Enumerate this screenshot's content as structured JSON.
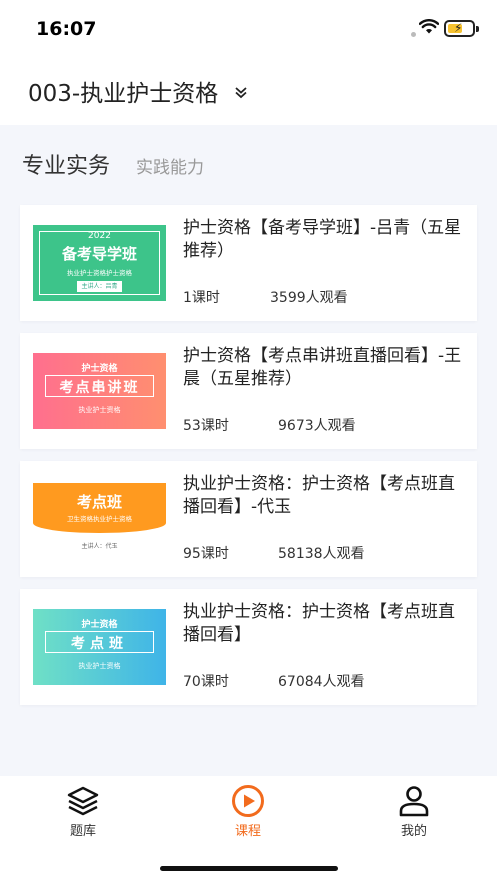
{
  "status_bar": {
    "time": "16:07"
  },
  "header": {
    "exam_title": "003-执业护士资格"
  },
  "tabs": [
    {
      "label": "专业实务",
      "active": true
    },
    {
      "label": "实践能力",
      "active": false
    }
  ],
  "courses": [
    {
      "title": "护士资格【备考导学班】-吕青（五星推荐）",
      "lessons": "1课时",
      "views": "3599人观看",
      "cover": {
        "year": "2022",
        "main": "备考导学班",
        "sub": "执业护士资格护士资格",
        "tag": "主讲人：吕青"
      }
    },
    {
      "title": "护士资格【考点串讲班直播回看】-王晨（五星推荐）",
      "lessons": "53课时",
      "views": "9673人观看",
      "cover": {
        "top": "护士资格",
        "main": "考点串讲班",
        "sub": "执业护士资格"
      }
    },
    {
      "title": "执业护士资格：护士资格【考点班直播回看】-代玉",
      "lessons": "95课时",
      "views": "58138人观看",
      "cover": {
        "main": "考点班",
        "sub": "卫生资格执业护士资格",
        "tag": "主讲人：代玉"
      }
    },
    {
      "title": "执业护士资格：护士资格【考点班直播回看】",
      "lessons": "70课时",
      "views": "67084人观看",
      "cover": {
        "top": "护士资格",
        "main": "考点班",
        "sub": "执业护士资格"
      }
    }
  ],
  "tab_bar": {
    "items": [
      {
        "label": "题库",
        "icon": "layers-icon"
      },
      {
        "label": "课程",
        "icon": "play-icon",
        "active": true
      },
      {
        "label": "我的",
        "icon": "user-icon"
      }
    ],
    "accent": "#f26b1d"
  }
}
